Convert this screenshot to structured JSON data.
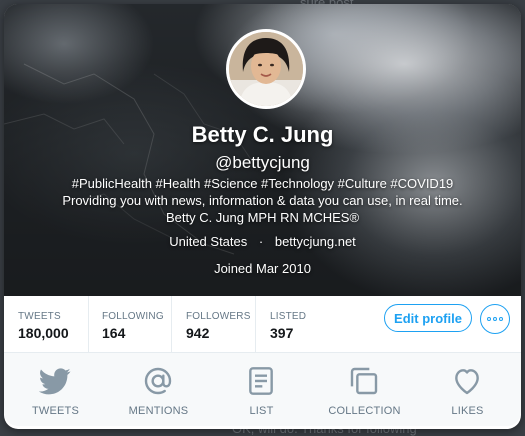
{
  "backdrop": {
    "top_text": "sure post",
    "bottom_text": "OK, will do. Thanks for following"
  },
  "profile": {
    "name": "Betty C. Jung",
    "handle": "@bettycjung",
    "bio_lines": [
      "#PublicHealth #Health #Science #Technology #Culture #COVID19",
      "Providing you with news, information & data you can use, in real time.",
      "Betty C. Jung MPH RN MCHES®"
    ],
    "location": "United States",
    "separator": "·",
    "website": "bettycjung.net",
    "joined": "Joined Mar 2010"
  },
  "stats": [
    {
      "label": "TWEETS",
      "value": "180,000"
    },
    {
      "label": "FOLLOWING",
      "value": "164"
    },
    {
      "label": "FOLLOWERS",
      "value": "942"
    },
    {
      "label": "LISTED",
      "value": "397"
    }
  ],
  "actions": {
    "edit_profile": "Edit profile",
    "more_icon": "more-dots-icon"
  },
  "tabs": [
    {
      "label": "TWEETS",
      "icon": "bird-icon"
    },
    {
      "label": "MENTIONS",
      "icon": "at-icon"
    },
    {
      "label": "LIST",
      "icon": "list-icon"
    },
    {
      "label": "COLLECTION",
      "icon": "collection-icon"
    },
    {
      "label": "LIKES",
      "icon": "heart-icon"
    }
  ],
  "colors": {
    "accent": "#1da1f2",
    "muted": "#657786",
    "icon": "#8899a6"
  }
}
